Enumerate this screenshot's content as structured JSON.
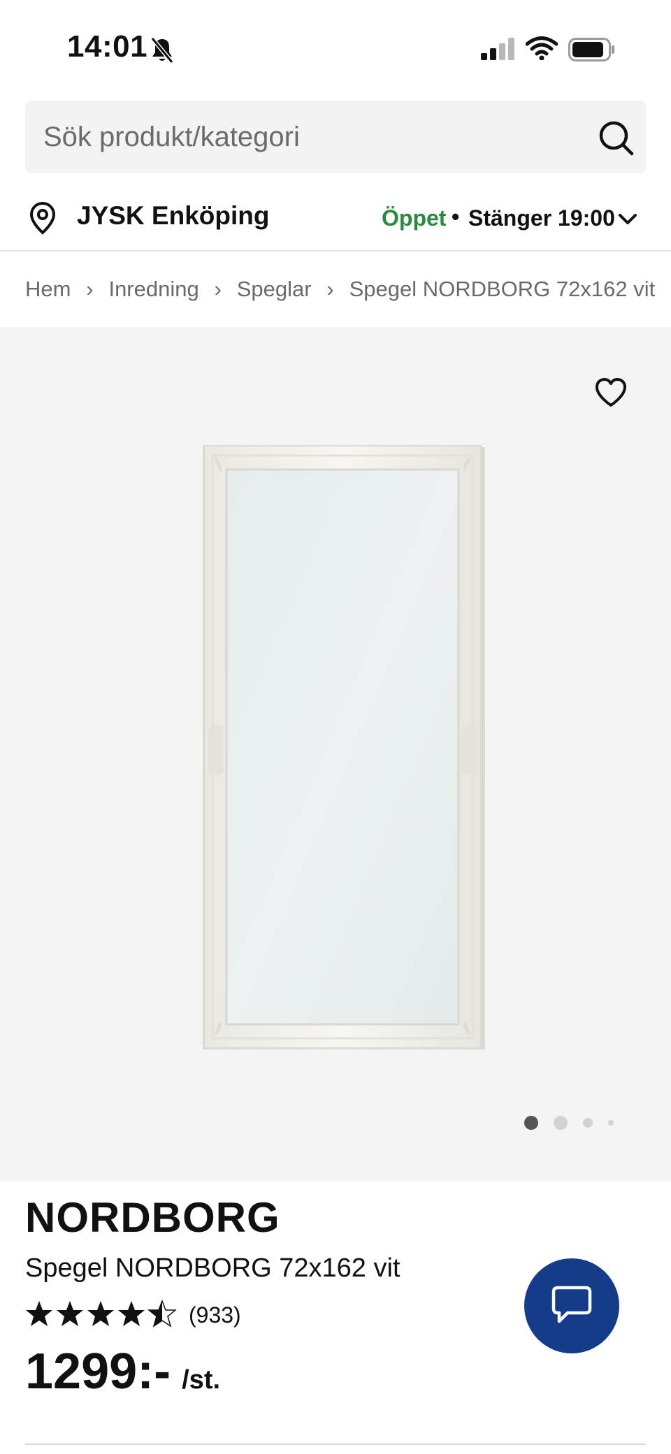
{
  "status_bar": {
    "time": "14:01",
    "icons": [
      "bell-slash-icon",
      "signal-icon",
      "wifi-icon",
      "battery-icon"
    ]
  },
  "search": {
    "placeholder": "Sök produkt/kategori",
    "icon": "search-icon"
  },
  "store": {
    "icon": "pin-icon",
    "name": "JYSK Enköping",
    "status": "Öppet",
    "separator": "•",
    "closing": "Stänger 19:00",
    "status_color": "#2a8a3e"
  },
  "breadcrumb": {
    "items": [
      "Hem",
      "Inredning",
      "Speglar",
      "Spegel NORDBORG 72x162 vit"
    ],
    "separator": "›"
  },
  "gallery": {
    "image": "white framed mirror",
    "favorite_icon": "heart-icon",
    "page_count": 4,
    "active_page": 1
  },
  "product": {
    "brand": "NORDBORG",
    "name": "Spegel NORDBORG 72x162 vit",
    "rating": 4.5,
    "rating_max": 5,
    "review_count": "(933)",
    "price": "1299:-",
    "price_unit": "/st."
  },
  "chat": {
    "icon": "chat-bubble-icon",
    "color": "#143c8a"
  }
}
